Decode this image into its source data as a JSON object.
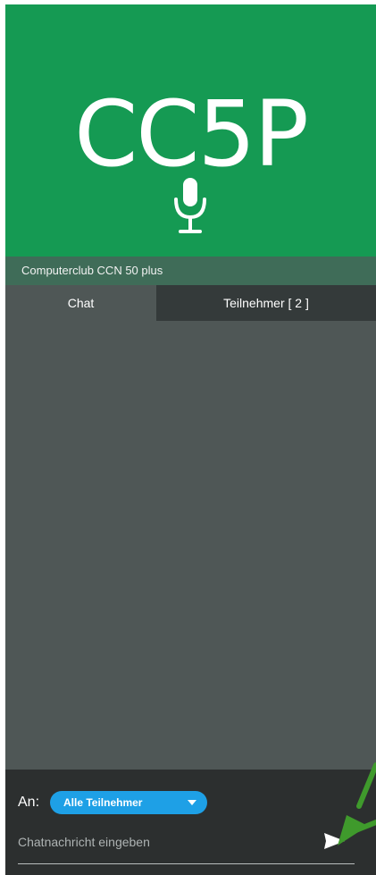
{
  "header": {
    "logo_text": "CC5P",
    "subtitle": "Computerclub CCN 50 plus"
  },
  "tabs": [
    {
      "label": "Chat",
      "active": true
    },
    {
      "label": "Teilnehmer [ 2 ]",
      "active": false
    }
  ],
  "composer": {
    "to_label": "An:",
    "recipient": "Alle Teilnehmer",
    "placeholder": "Chatnachricht eingeben"
  },
  "icons": {
    "logo_microphone": "microphone-icon",
    "recipient_dropdown": "caret-down-icon",
    "send": "send-icon",
    "annotation": "arrow-icon"
  },
  "colors": {
    "header_green": "#159a53",
    "subtitle_bar": "#3f6c58",
    "panel": "#4f5756",
    "inactive_tab": "#343a3a",
    "footer": "#2c2f2f",
    "recipient_blue": "#1ea0e6",
    "annotation_arrow": "#3f9a2c"
  }
}
